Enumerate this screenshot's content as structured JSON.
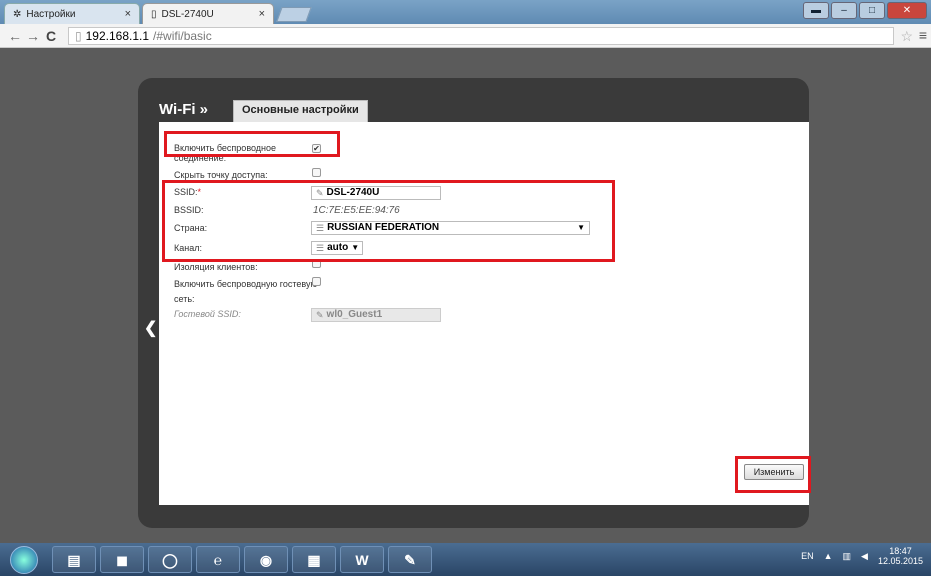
{
  "browser": {
    "tabs": [
      {
        "label": "Настройки",
        "icon": "settings-icon"
      },
      {
        "label": "DSL-2740U",
        "icon": "page-icon"
      }
    ],
    "tab_close": "×",
    "url_host": "192.168.1.1",
    "url_path": "/#wifi/basic"
  },
  "router": {
    "section": "Wi-Fi »",
    "tab": "Основные настройки",
    "fields": {
      "enable_wireless_1": "Включить беспроводное",
      "enable_wireless_2": "соединение:",
      "hide_ap": "Скрыть точку доступа:",
      "ssid": "SSID:",
      "ssid_required": "*",
      "ssid_value": "DSL-2740U",
      "bssid": "BSSID:",
      "bssid_value": "1C:7E:E5:EE:94:76",
      "country": "Страна:",
      "country_value": "RUSSIAN FEDERATION",
      "channel": "Канал:",
      "channel_value": "auto",
      "client_isolation": "Изоляция клиентов:",
      "guest_1": "Включить беспроводную гостевую",
      "guest_2": "сеть:",
      "guest_ssid": "Гостевой SSID:",
      "guest_ssid_value": "wl0_Guest1"
    },
    "checkboxes": {
      "enable_wireless": true,
      "hide_ap": false,
      "client_isolation": false,
      "guest": false
    },
    "apply_button": "Изменить"
  },
  "taskbar": {
    "lang": "EN",
    "time": "18:47",
    "date": "12.05.2015"
  },
  "colors": {
    "highlight": "#e0181f",
    "panel": "#3a3a3a"
  }
}
